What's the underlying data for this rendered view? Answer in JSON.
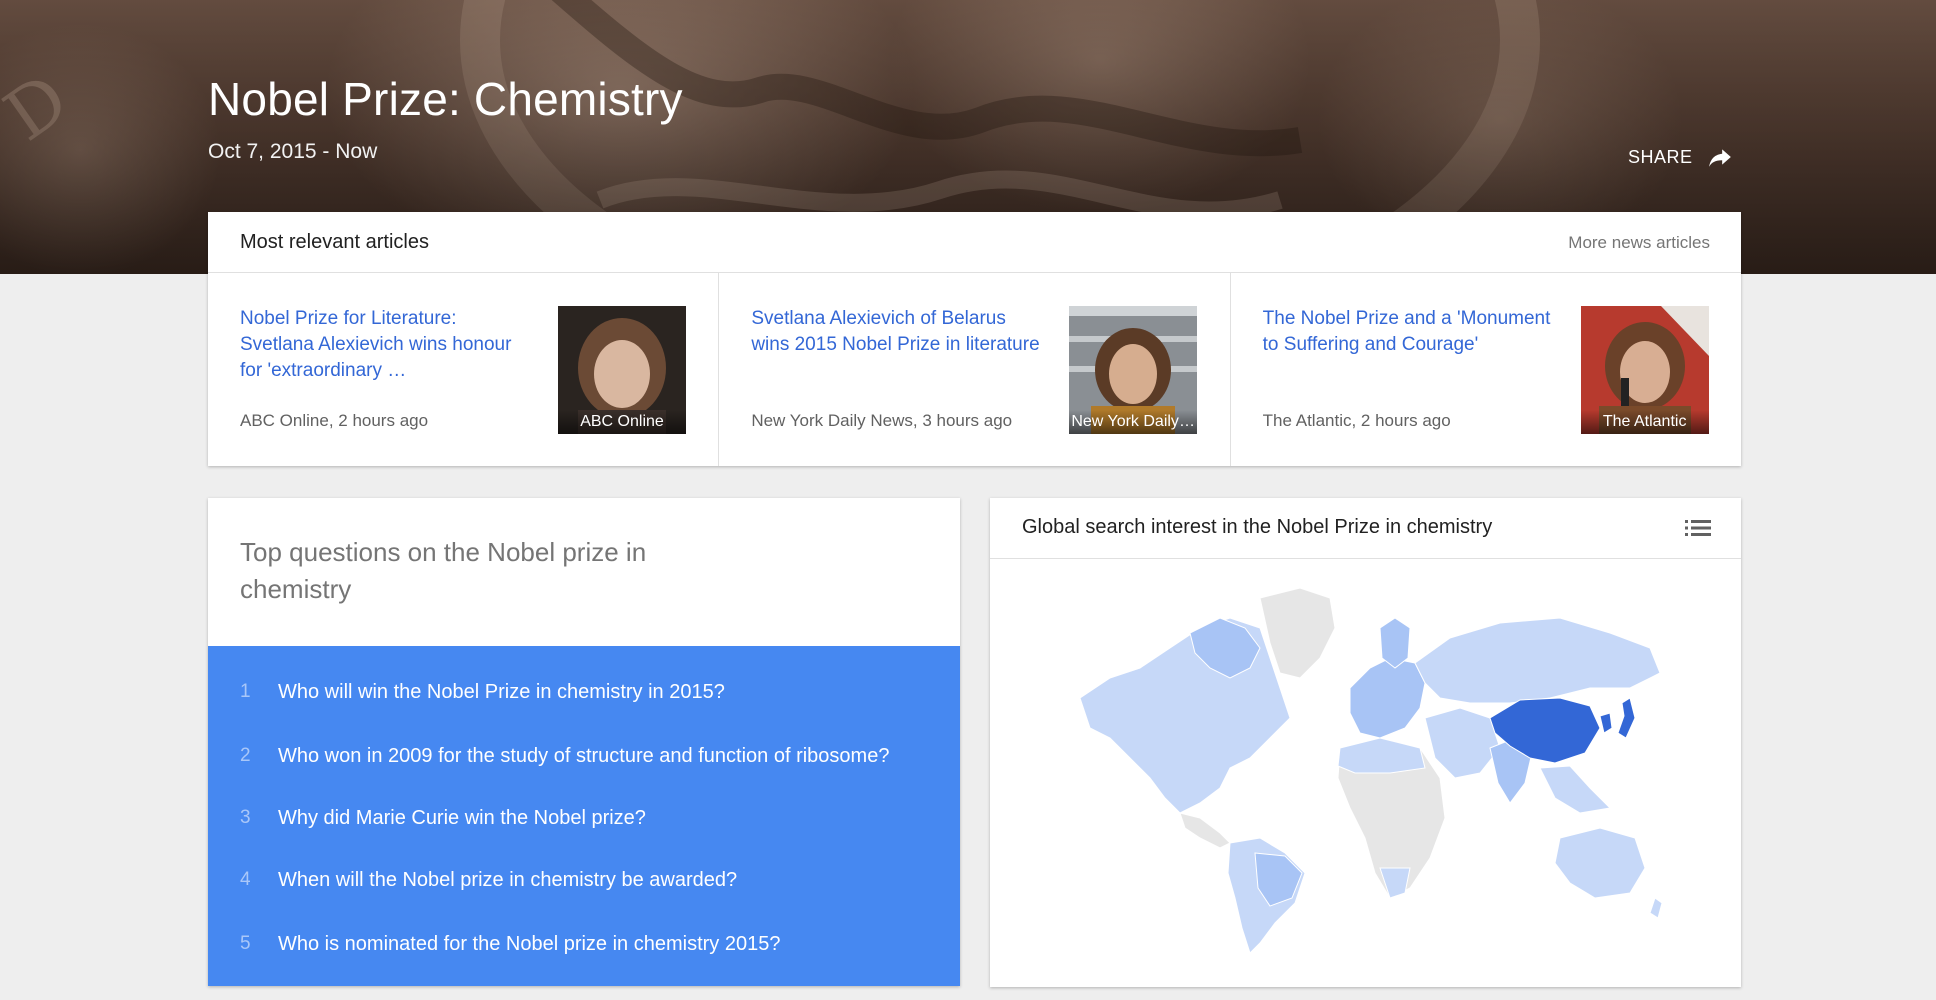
{
  "hero": {
    "title": "Nobel Prize: Chemistry",
    "date_range": "Oct 7, 2015 - Now",
    "share_label": "SHARE"
  },
  "articles": {
    "heading": "Most relevant articles",
    "more_link": "More news articles",
    "items": [
      {
        "title": "Nobel Prize for Literature: Svetlana Alexievich wins honour for 'extraordinary …",
        "meta": "ABC Online, 2 hours ago",
        "thumb_caption": "ABC Online"
      },
      {
        "title": "Svetlana Alexievich of Belarus wins 2015 Nobel Prize in literature",
        "meta": "New York Daily News, 3 hours ago",
        "thumb_caption": "New York Daily News"
      },
      {
        "title": "The Nobel Prize and a 'Monument to Suffering and Courage'",
        "meta": "The Atlantic, 2 hours ago",
        "thumb_caption": "The Atlantic"
      }
    ]
  },
  "questions": {
    "heading": "Top questions on the Nobel prize in chemistry",
    "items": [
      {
        "num": "1",
        "text": "Who will win the Nobel Prize in chemistry in 2015?"
      },
      {
        "num": "2",
        "text": "Who won in 2009 for the study of structure and function of ribosome?"
      },
      {
        "num": "3",
        "text": "Why did Marie Curie win the Nobel prize?"
      },
      {
        "num": "4",
        "text": "When will the Nobel prize in chemistry be awarded?"
      },
      {
        "num": "5",
        "text": "Who is nominated for the Nobel prize in chemistry 2015?"
      }
    ]
  },
  "map": {
    "heading": "Global search interest in the Nobel Prize in chemistry",
    "menu_icon": "list-icon",
    "colors": {
      "high": "#3367d6",
      "medium": "#a8c4f5",
      "low": "#c6d8f8",
      "none": "#e6e6e6"
    }
  },
  "colors": {
    "link": "#3367d6",
    "questions_bg": "#4688f1",
    "page_bg": "#eeeeee"
  }
}
